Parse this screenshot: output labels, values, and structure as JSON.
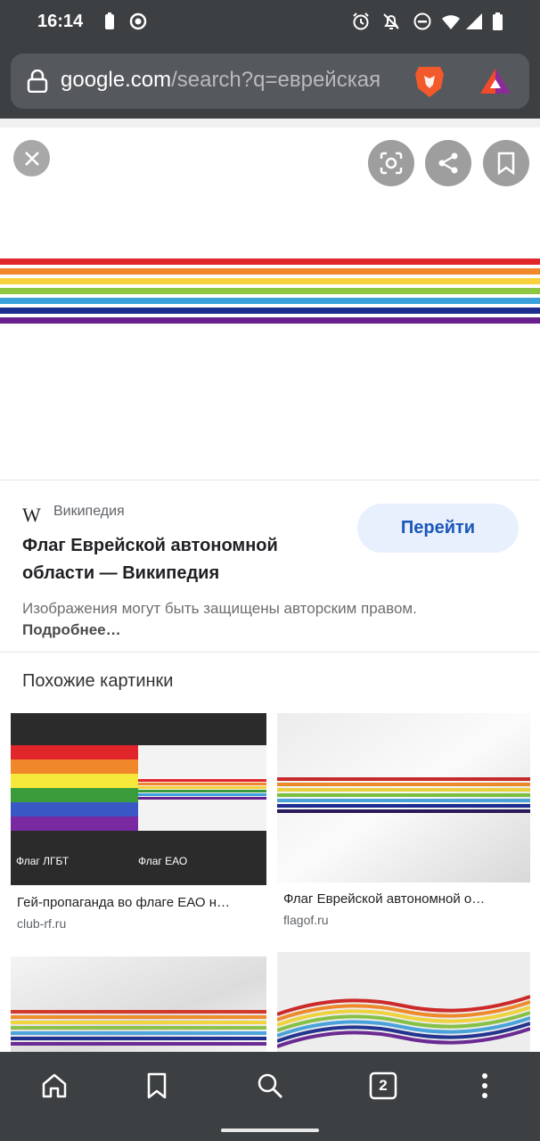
{
  "status_bar": {
    "time": "16:14",
    "icons": [
      "battery-saver-icon",
      "record-icon",
      "alarm-icon",
      "notifications-off-icon",
      "dnd-icon",
      "wifi-icon",
      "signal-icon",
      "battery-icon"
    ]
  },
  "url_bar": {
    "domain": "google.com",
    "path": "/search?q=еврейская",
    "icons": [
      "lock-icon",
      "brave-lion-icon",
      "bat-rewards-icon"
    ]
  },
  "viewer": {
    "buttons": [
      "close-icon",
      "lens-icon",
      "share-icon",
      "bookmark-icon"
    ],
    "flag_colors": [
      "#e0252b",
      "#f0872a",
      "#f7d23c",
      "#8ec63f",
      "#3aa0da",
      "#1c2c8f",
      "#6a1f8f"
    ]
  },
  "result": {
    "source": "Википедия",
    "title": "Флаг Еврейской автономной области — Википедия",
    "goto_button": "Перейти",
    "notice_text": "Изображения могут быть защищены авторским правом.",
    "notice_link": "Подробнее…"
  },
  "similar": {
    "heading": "Похожие картинки",
    "items": [
      {
        "caption": "Гей-пропаганда во флаге ЕАО н…",
        "domain": "club-rf.ru",
        "label_left": "Флаг ЛГБТ",
        "label_right": "Флаг ЕАО"
      },
      {
        "caption": "Флаг Еврейской автономной о…",
        "domain": "flagof.ru"
      },
      {
        "caption": "",
        "domain": ""
      },
      {
        "caption": "",
        "domain": ""
      }
    ]
  },
  "bottom_nav": {
    "tab_count": "2",
    "icons": [
      "home-icon",
      "bookmarks-icon",
      "search-icon",
      "tabs-icon",
      "menu-icon"
    ]
  }
}
